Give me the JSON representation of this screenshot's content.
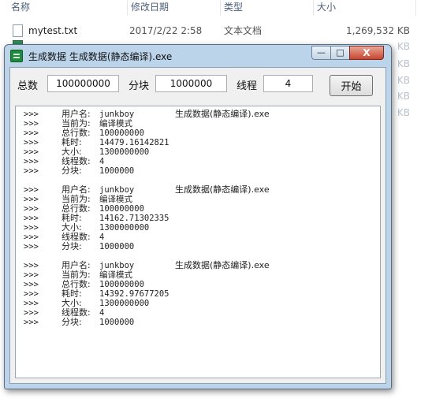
{
  "explorer": {
    "columns": {
      "name": "名称",
      "modified": "修改日期",
      "type": "类型",
      "size": "大小"
    },
    "rows": [
      {
        "name": "mytest.txt",
        "modified": "2017/2/22 2:58",
        "type": "文本文档",
        "size": "1,269,532 KB"
      }
    ],
    "ghost_sizes": [
      "KB",
      "KB",
      "KB",
      "KB",
      "KB"
    ]
  },
  "window": {
    "title": "生成数据  生成数据(静态编译).exe",
    "caption": {
      "minimize": "—",
      "maximize": "□",
      "close": "X"
    },
    "toolbar": {
      "total_label": "总数",
      "total_value": "100000000",
      "block_label": "分块",
      "block_value": "1000000",
      "threads_label": "线程",
      "threads_value": "4",
      "start_label": "开始"
    },
    "log": {
      "prompt": ">>>",
      "entries": [
        {
          "lines": [
            {
              "key": "用户名:",
              "value": "junkboy",
              "exe": "生成数据(静态编译).exe"
            },
            {
              "key": "当前为:",
              "value": "编译模式"
            },
            {
              "key": "总行数:",
              "value": "100000000"
            },
            {
              "key": "耗时:",
              "value": "14479.16142821"
            },
            {
              "key": "大小:",
              "value": "1300000000"
            },
            {
              "key": "线程数:",
              "value": "4"
            },
            {
              "key": "分块:",
              "value": "1000000"
            }
          ]
        },
        {
          "lines": [
            {
              "key": "用户名:",
              "value": "junkboy",
              "exe": "生成数据(静态编译).exe"
            },
            {
              "key": "当前为:",
              "value": "编译模式"
            },
            {
              "key": "总行数:",
              "value": "100000000"
            },
            {
              "key": "耗时:",
              "value": "14162.71302335"
            },
            {
              "key": "大小:",
              "value": "1300000000"
            },
            {
              "key": "线程数:",
              "value": "4"
            },
            {
              "key": "分块:",
              "value": "1000000"
            }
          ]
        },
        {
          "lines": [
            {
              "key": "用户名:",
              "value": "junkboy",
              "exe": "生成数据(静态编译).exe"
            },
            {
              "key": "当前为:",
              "value": "编译模式"
            },
            {
              "key": "总行数:",
              "value": "100000000"
            },
            {
              "key": "耗时:",
              "value": "14392.97677205"
            },
            {
              "key": "大小:",
              "value": "1300000000"
            },
            {
              "key": "线程数:",
              "value": "4"
            },
            {
              "key": "分块:",
              "value": "1000000"
            }
          ]
        }
      ]
    }
  }
}
